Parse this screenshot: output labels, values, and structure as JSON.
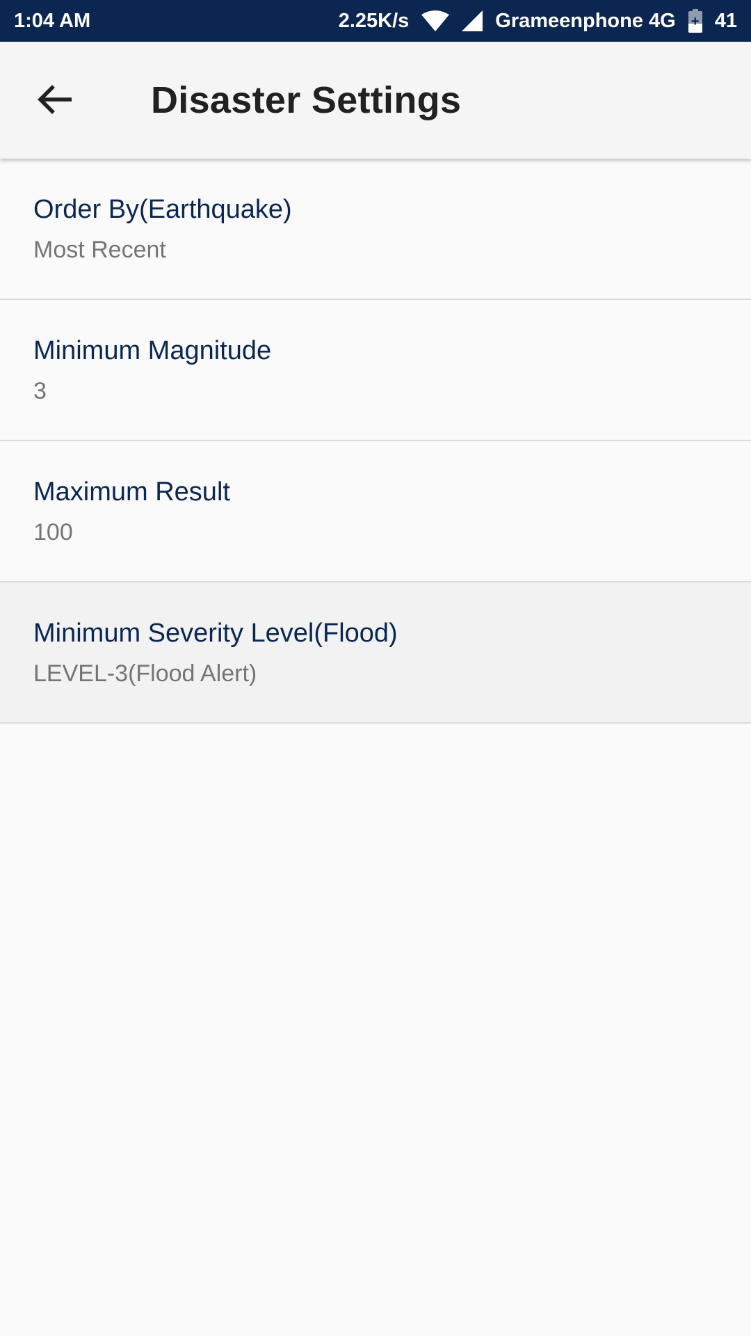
{
  "status_bar": {
    "time": "1:04 AM",
    "net_speed": "2.25K/s",
    "carrier": "Grameenphone 4G",
    "battery_level": "41",
    "battery_fraction": 0.41,
    "background_color": "#0b2751"
  },
  "app_bar": {
    "title": "Disaster Settings",
    "back_icon": "arrow-back-icon"
  },
  "settings": [
    {
      "title": "Order By(Earthquake)",
      "summary": "Most Recent"
    },
    {
      "title": "Minimum Magnitude",
      "summary": "3"
    },
    {
      "title": "Maximum Result",
      "summary": "100"
    },
    {
      "title": "Minimum Severity Level(Flood)",
      "summary": "LEVEL-3(Flood Alert)"
    }
  ],
  "colors": {
    "title_text": "#0b2751",
    "summary_text": "#757575",
    "divider": "#dcdcdc"
  }
}
